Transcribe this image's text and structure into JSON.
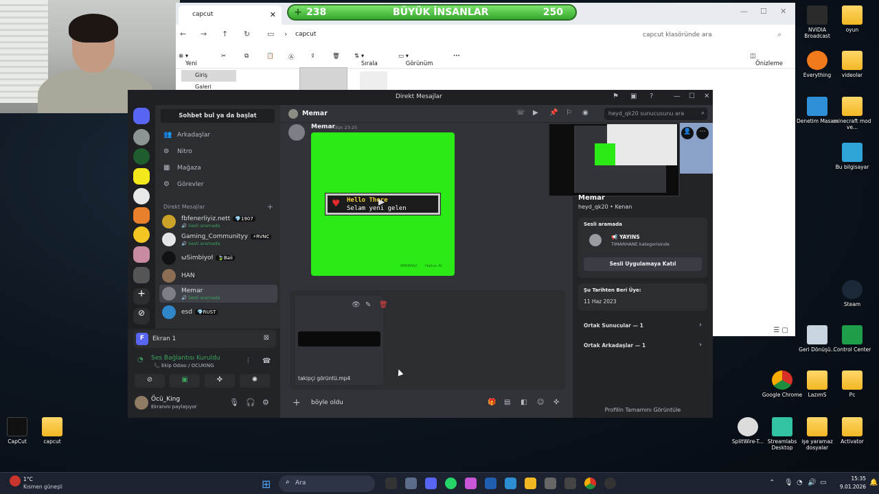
{
  "banner": {
    "plus": "+",
    "left_count": "238",
    "title": "BÜYÜK İNSANLAR",
    "right_count": "250"
  },
  "explorer": {
    "tab_title": "capcut",
    "path": "capcut",
    "search_placeholder": "capcut klasöründe ara",
    "toolbar": {
      "new": "Yeni",
      "sort": "Sırala",
      "view": "Görünüm",
      "more": "···",
      "preview": "Önizleme"
    },
    "sidebar": [
      "Giriş",
      "Galeri"
    ]
  },
  "discord": {
    "window_title": "Direkt Mesajlar",
    "find_label": "Sohbet bul ya da başlat",
    "nav": [
      {
        "icon": "friends-icon",
        "glyph": "👥",
        "label": "Arkadaşlar"
      },
      {
        "icon": "nitro-icon",
        "glyph": "⊚",
        "label": "Nitro"
      },
      {
        "icon": "shop-icon",
        "glyph": "▦",
        "label": "Mağaza"
      },
      {
        "icon": "quests-icon",
        "glyph": "⚙",
        "label": "Görevler"
      }
    ],
    "dm_header": "Direkt Mesajlar",
    "dms": [
      {
        "name": "fbfenerliyiz.nett",
        "tag": "💎1907",
        "status": "🔊 Sesli aramada",
        "color": "#c9a227"
      },
      {
        "name": "Gaming_Communityy",
        "tag": "⚡RVNC",
        "status": "🔊 Sesli aramada",
        "color": "#e3e5e8"
      },
      {
        "name": "ωSimbiyoł",
        "tag": "🍃Bəii",
        "status": "",
        "color": "#111214"
      },
      {
        "name": "HAN",
        "tag": "",
        "status": "",
        "color": "#8c6e55"
      },
      {
        "name": "Memar",
        "tag": "",
        "status": "🔊 Sesli aramada",
        "color": "#7c7f86"
      },
      {
        "name": "esd",
        "tag": "💎RUST",
        "status": "",
        "color": "#2f86c9"
      }
    ],
    "screen_share": {
      "avatar_letter": "F",
      "label": "Ekran 1"
    },
    "voice": {
      "status": "Ses Bağlantısı Kuruldu",
      "channel": "📞 Ekip Odası / OCUKING"
    },
    "user": {
      "name": "Öcü_King",
      "status": "Ekranını paylaşıyor"
    },
    "chat": {
      "channel_name": "Memar",
      "search_placeholder": "heyd_qk20 sunucusunu ara",
      "message": {
        "author": "Memar",
        "time": "dün 23:25"
      },
      "video_text": {
        "line1": "Hello There",
        "line2": "Selam yeni gelen",
        "wm1": "MINIMAX",
        "wm2": "Hailuo AI"
      },
      "attachment_name": "takipçi görüntü.mp4",
      "input_text": "böyle oldu"
    },
    "profile": {
      "name": "Memar",
      "username": "heyd_qk20 • Kenan",
      "voice_header": "Sesli aramada",
      "guild": "📢 YAYINS",
      "guild_sub": "TIMARHANE kategorisinde",
      "join_button": "Sesli Uygulamaya Katıl",
      "member_since_label": "Şu Tarihten Beri Üye:",
      "member_since": "11 Haz 2023",
      "mutual_servers": "Ortak Sunucular — 1",
      "mutual_friends": "Ortak Arkadaşlar — 1",
      "view_full": "Profilin Tamamını Görüntüle"
    }
  },
  "desktop": {
    "icons": [
      {
        "id": "nvidia",
        "label": "NVIDIA Broadcast",
        "color": "#2b2b2b"
      },
      {
        "id": "oyun",
        "label": "oyun",
        "color": "folder"
      },
      {
        "id": "everything",
        "label": "Everything",
        "color": "#f27a1a"
      },
      {
        "id": "videolar",
        "label": "videolar",
        "color": "folder"
      },
      {
        "id": "denetim",
        "label": "Denetim Masası",
        "color": "#2f8fd6"
      },
      {
        "id": "minecraft",
        "label": "minecraft mod ve...",
        "color": "folder"
      },
      {
        "id": "bilgisayar",
        "label": "Bu bilgisayar",
        "color": "#2fa4d8"
      },
      {
        "id": "steam",
        "label": "Steam",
        "color": "#1b2838"
      },
      {
        "id": "geri",
        "label": "Geri Dönüşü...",
        "color": "#c8d4e0"
      },
      {
        "id": "control",
        "label": "Control Center",
        "color": "#1e9e4a"
      },
      {
        "id": "chrome",
        "label": "Google Chrome",
        "color": "#d93025"
      },
      {
        "id": "lazims",
        "label": "LazımS",
        "color": "folder"
      },
      {
        "id": "pc",
        "label": "Pc",
        "color": "folder"
      },
      {
        "id": "splitwire",
        "label": "SplitWire-T...",
        "color": "#dcdcdc"
      },
      {
        "id": "streamlabs",
        "label": "Streamlabs Desktop",
        "color": "#31c3a2"
      },
      {
        "id": "ise",
        "label": "işe yaramaz dosyalar",
        "color": "folder"
      },
      {
        "id": "activator",
        "label": "Activator",
        "color": "folder"
      },
      {
        "id": "capcut-app",
        "label": "CapCut",
        "color": "#111111"
      },
      {
        "id": "capcut-folder",
        "label": "capcut",
        "color": "folder"
      }
    ]
  },
  "taskbar": {
    "temp": "1°C",
    "weather": "Kısmen güneşli",
    "search": "Ara",
    "time": "15:35",
    "date": "9.01.2026"
  }
}
